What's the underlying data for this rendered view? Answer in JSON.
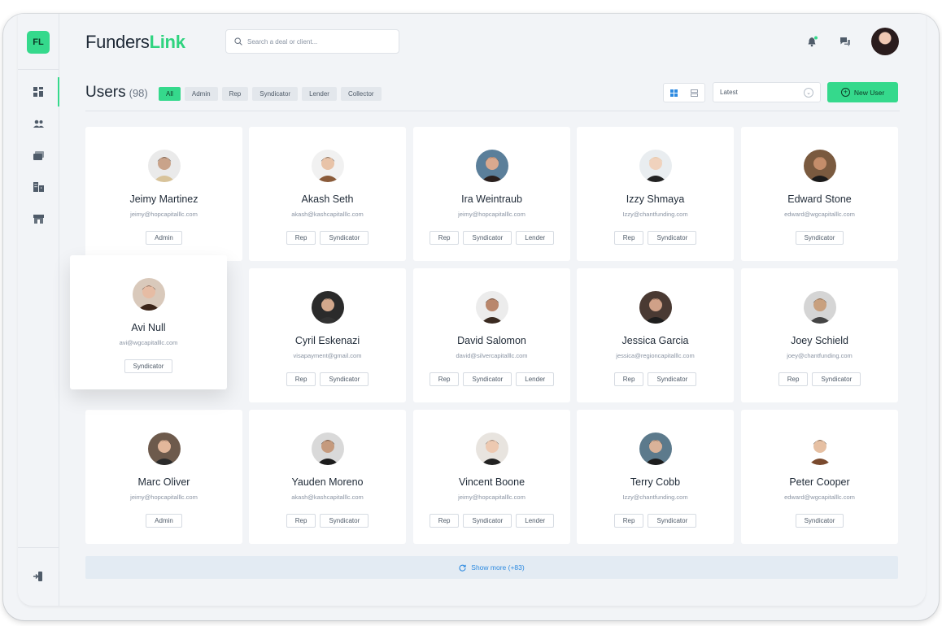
{
  "app": {
    "logo_badge": "FL",
    "brand_first": "Funders",
    "brand_second": "Link"
  },
  "search": {
    "placeholder": "Search a deal or client..."
  },
  "page": {
    "title": "Users",
    "count": "(98)"
  },
  "filters": [
    "All",
    "Admin",
    "Rep",
    "Syndicator",
    "Lender",
    "Collector"
  ],
  "sort": {
    "selected": "Latest"
  },
  "new_user_label": "New User",
  "show_more_label": "Show more (+83)",
  "colors": {
    "accent": "#35d98c",
    "link": "#2d8ae0",
    "background": "#f2f4f7"
  },
  "icons": {
    "sidebar": [
      "dashboard-icon",
      "users-icon",
      "deals-icon",
      "buildings-icon",
      "store-icon"
    ],
    "logout": "logout-icon",
    "top": [
      "notification-bell-icon",
      "chat-icon"
    ]
  },
  "users": [
    {
      "name": "Jeimy Martinez",
      "email": "jeimy@hopcapitalllc.com",
      "roles": [
        "Admin"
      ]
    },
    {
      "name": "Akash Seth",
      "email": "akash@kashcapitalllc.com",
      "roles": [
        "Rep",
        "Syndicator"
      ]
    },
    {
      "name": "Ira Weintraub",
      "email": "jeimy@hopcapitalllc.com",
      "roles": [
        "Rep",
        "Syndicator",
        "Lender"
      ]
    },
    {
      "name": "Izzy Shmaya",
      "email": "Izzy@chantfunding.com",
      "roles": [
        "Rep",
        "Syndicator"
      ]
    },
    {
      "name": "Edward Stone",
      "email": "edward@wgcapitalllc.com",
      "roles": [
        "Syndicator"
      ]
    },
    {
      "name": "Avi Null",
      "email": "avi@wgcapitalllc.com",
      "roles": [
        "Syndicator"
      ]
    },
    {
      "name": "Cyril Eskenazi",
      "email": "visapayment@gmail.com",
      "roles": [
        "Rep",
        "Syndicator"
      ]
    },
    {
      "name": "David Salomon",
      "email": "david@silvercapitalllc.com",
      "roles": [
        "Rep",
        "Syndicator",
        "Lender"
      ]
    },
    {
      "name": "Jessica Garcia",
      "email": "jessica@regioncapitalllc.com",
      "roles": [
        "Rep",
        "Syndicator"
      ]
    },
    {
      "name": "Joey Schield",
      "email": "joey@chantfunding.com",
      "roles": [
        "Rep",
        "Syndicator"
      ]
    },
    {
      "name": "Marc Oliver",
      "email": "jeimy@hopcapitalllc.com",
      "roles": [
        "Admin"
      ]
    },
    {
      "name": "Yauden Moreno",
      "email": "akash@kashcapitalllc.com",
      "roles": [
        "Rep",
        "Syndicator"
      ]
    },
    {
      "name": "Vincent Boone",
      "email": "jeimy@hopcapitalllc.com",
      "roles": [
        "Rep",
        "Syndicator",
        "Lender"
      ]
    },
    {
      "name": "Terry Cobb",
      "email": "Izzy@chantfunding.com",
      "roles": [
        "Rep",
        "Syndicator"
      ]
    },
    {
      "name": "Peter Cooper",
      "email": "edward@wgcapitalllc.com",
      "roles": [
        "Syndicator"
      ]
    }
  ]
}
